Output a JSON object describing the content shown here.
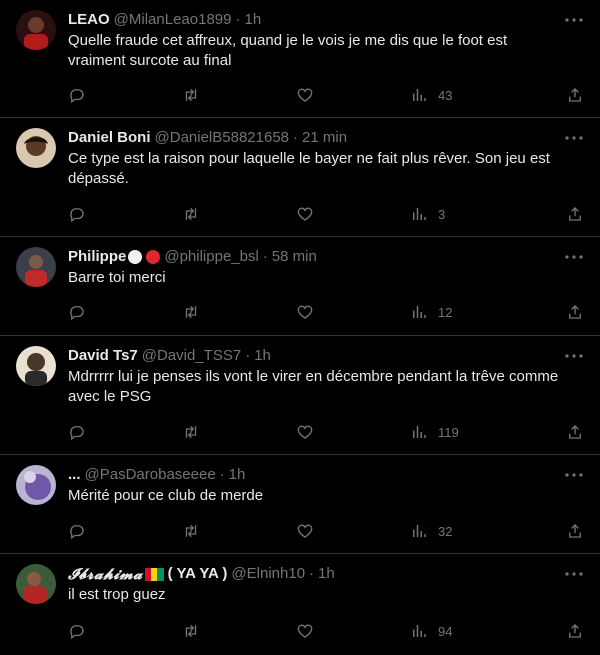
{
  "tweets": [
    {
      "name": "LEAO",
      "handle": "@MilanLeao1899",
      "time": "1h",
      "text": "Quelle fraude cet affreux, quand je le vois je me dis que le foot est vraiment surcote au final",
      "views": "43",
      "avatar_color": "#8b1d1d"
    },
    {
      "name": "Daniel Boni",
      "handle": "@DanielB58821658",
      "time": "21 min",
      "text": "Ce type est la raison pour laquelle le bayer ne fait plus rêver. Son jeu est dépassé.",
      "views": "3",
      "avatar_color": "#5a3a22"
    },
    {
      "name": "Philippe",
      "handle": "@philippe_bsl",
      "time": "58 min",
      "text": "Barre toi merci",
      "views": "12",
      "avatar_color": "#a02424"
    },
    {
      "name": "David Ts7",
      "handle": "@David_TSS7",
      "time": "1h",
      "text": "Mdrrrrr lui je penses ils vont le virer en décembre pendant la trêve comme avec le PSG",
      "views": "119",
      "avatar_color": "#6b5436"
    },
    {
      "name": "...",
      "handle": "@PasDarobaseeee",
      "time": "1h",
      "text": "Mérité pour ce club de merde",
      "views": "32",
      "avatar_color": "#8d82b8"
    },
    {
      "name": "𝓘𝓫𝓻𝓪𝓱𝓲𝓶𝓪",
      "name_suffix": "( YA YA )",
      "handle": "@Elninh10",
      "time": "1h",
      "text": "il est trop guez",
      "views": "94",
      "avatar_color": "#9a2a2a"
    }
  ],
  "separator": "·",
  "icons": [
    "reply-icon",
    "retweet-icon",
    "like-icon",
    "views-icon",
    "share-icon",
    "more-icon"
  ],
  "colors": {
    "background": "#000000",
    "text": "#e7e9ea",
    "muted": "#71767b",
    "border": "#2f3336"
  }
}
